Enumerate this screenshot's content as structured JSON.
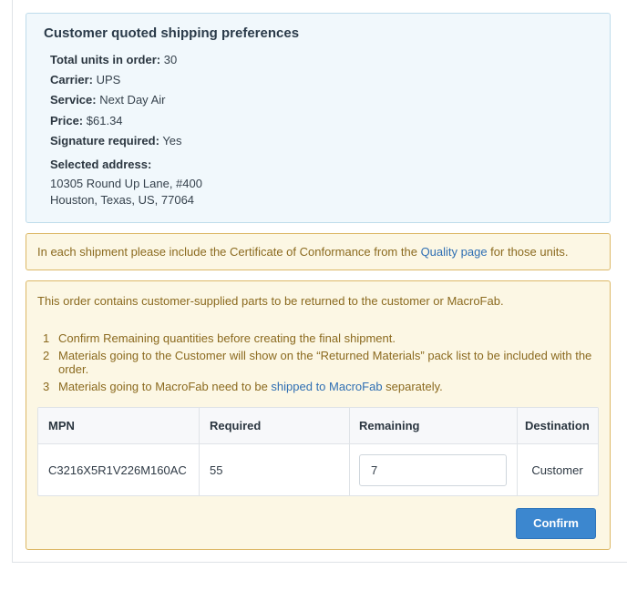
{
  "shipping_prefs": {
    "title": "Customer quoted shipping preferences",
    "total_units_label": "Total units in order:",
    "total_units_value": "30",
    "carrier_label": "Carrier:",
    "carrier_value": "UPS",
    "service_label": "Service:",
    "service_value": "Next Day Air",
    "price_label": "Price:",
    "price_value": "$61.34",
    "signature_label": "Signature required:",
    "signature_value": "Yes",
    "address_label": "Selected address:",
    "address_line1": "10305 Round Up Lane, #400",
    "address_line2": "Houston, Texas, US, 77064"
  },
  "coc_notice": {
    "prefix": "In each shipment please include the Certificate of Conformance from the ",
    "link": "Quality page",
    "suffix": " for those units."
  },
  "return_notice": {
    "intro": "This order contains customer-supplied parts to be returned to the customer or MacroFab.",
    "steps": [
      {
        "num": "1",
        "text": "Confirm Remaining quantities before creating the final shipment."
      },
      {
        "num": "2",
        "text": "Materials going to the Customer will show on the “Returned Materials” pack list to be included with the order."
      },
      {
        "num": "3",
        "prefix": "Materials going to MacroFab need to be ",
        "link": "shipped to MacroFab",
        "suffix": " separately."
      }
    ]
  },
  "parts_table": {
    "headers": [
      "MPN",
      "Required",
      "Remaining",
      "Destination"
    ],
    "rows": [
      {
        "mpn": "C3216X5R1V226M160AC",
        "required": "55",
        "remaining": "7",
        "destination": "Customer"
      }
    ]
  },
  "confirm_label": "Confirm"
}
